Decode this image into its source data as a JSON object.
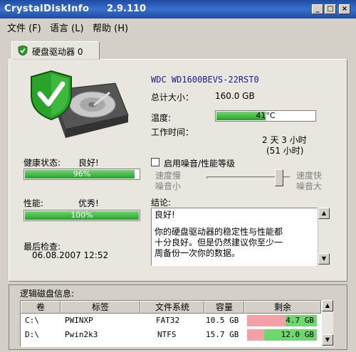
{
  "window": {
    "title": "CrystalDiskInfo",
    "version": "2.9.110",
    "btn_min": "_",
    "btn_max": "□",
    "btn_close": "×"
  },
  "menu": {
    "file": "文件 (F)",
    "language": "语言 (L)",
    "help": "帮助 (H)"
  },
  "tab": {
    "label": "硬盘驱动器 0"
  },
  "disk": {
    "model": "WDC WD1600BEVS-22RST0",
    "total_size_label": "总计大小：",
    "total_size_value": "160.0 GB",
    "temperature_label": "温度:",
    "temperature_value": "41°C",
    "temperature_fraction": 0.5,
    "uptime_label": "工作时间：",
    "uptime_value": "2 天 3 小时",
    "uptime_hours": "(51 小时)"
  },
  "health": {
    "label": "健康状态:",
    "status": "良好!",
    "percent_text": "96%",
    "fraction": 0.96
  },
  "performance": {
    "label": "性能:",
    "status": "优秀!",
    "percent_text": "100%",
    "fraction": 1.0
  },
  "last_check": {
    "label": "最后检查:",
    "value": "06.08.2007 12:52"
  },
  "noise": {
    "checkbox_label": "启用噪音/性能等级",
    "checked": false,
    "slow_line1": "速度慢",
    "slow_line2": "噪音小",
    "fast_line1": "速度快",
    "fast_line2": "噪音大"
  },
  "conclusion": {
    "label": "结论:",
    "line1": "良好!",
    "line2": "你的硬盘驱动器的稳定性与性能都",
    "line3": "十分良好。但是仍然建议你至少一",
    "line4": "周备份一次你的数据。"
  },
  "logical": {
    "title": "逻辑磁盘信息:",
    "columns": [
      "卷",
      "标签",
      "文件系统",
      "容量",
      "剩余"
    ],
    "rows": [
      {
        "volume": "C:\\",
        "label": "PWINXP",
        "fs": "FAT32",
        "capacity": "10.5 GB",
        "free": "4.7 GB",
        "free_fraction": 0.45
      },
      {
        "volume": "D:\\",
        "label": "Pwin2k3",
        "fs": "NTFS",
        "capacity": "15.7 GB",
        "free": "12.0 GB",
        "free_fraction": 0.76
      }
    ]
  },
  "colors": {
    "titlebar": "#1e4ca0",
    "good_green": "#28a028",
    "free_pink": "#f5a0a8"
  }
}
